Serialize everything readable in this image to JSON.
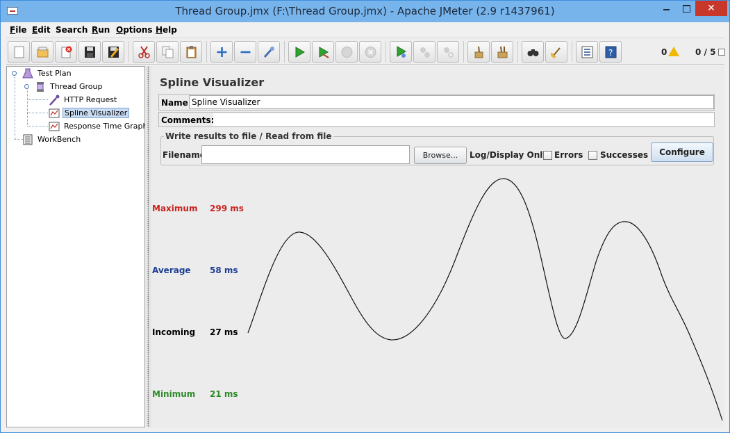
{
  "window": {
    "title": "Thread Group.jmx (F:\\Thread Group.jmx) - Apache JMeter (2.9 r1437961)",
    "controls": {
      "close": "✕"
    }
  },
  "menu": [
    {
      "accel": "F",
      "rest": "ile"
    },
    {
      "accel": "E",
      "rest": "dit"
    },
    {
      "accel": "",
      "rest": "Search"
    },
    {
      "accel": "R",
      "rest": "un"
    },
    {
      "accel": "O",
      "rest": "ptions"
    },
    {
      "accel": "H",
      "rest": "elp"
    }
  ],
  "toolbar": {
    "buttons": [
      {
        "icon": "new-icon"
      },
      {
        "icon": "open-icon"
      },
      {
        "icon": "close-file-icon"
      },
      {
        "icon": "save-icon"
      },
      {
        "icon": "save-as-icon"
      },
      {
        "icon": "cut-icon"
      },
      {
        "icon": "copy-icon"
      },
      {
        "icon": "paste-icon"
      },
      {
        "icon": "expand-icon"
      },
      {
        "icon": "collapse-icon"
      },
      {
        "icon": "toggle-icon"
      },
      {
        "icon": "start-icon"
      },
      {
        "icon": "start-no-timers-icon"
      },
      {
        "icon": "stop-icon"
      },
      {
        "icon": "shutdown-icon"
      },
      {
        "icon": "remote-start-icon"
      },
      {
        "icon": "remote-stop-icon"
      },
      {
        "icon": "remote-shutdown-icon"
      },
      {
        "icon": "clear-icon"
      },
      {
        "icon": "clear-all-icon"
      },
      {
        "icon": "search-icon"
      },
      {
        "icon": "reset-search-icon"
      },
      {
        "icon": "function-helper-icon"
      },
      {
        "icon": "help-icon"
      }
    ],
    "error_count": "0",
    "thread_count": "0 / 5"
  },
  "tree": {
    "items": [
      {
        "label": "Test Plan",
        "icon": "test-plan-icon"
      },
      {
        "label": "Thread Group",
        "icon": "thread-group-icon"
      },
      {
        "label": "HTTP Request",
        "icon": "sampler-pipette-icon"
      },
      {
        "label": "Spline Visualizer",
        "icon": "visualizer-icon"
      },
      {
        "label": "Response Time Graph",
        "icon": "visualizer-icon"
      },
      {
        "label": "WorkBench",
        "icon": "workbench-icon"
      }
    ],
    "selected": "Spline Visualizer"
  },
  "panel": {
    "title": "Spline Visualizer",
    "name_label": "Name:",
    "name_value": "Spline Visualizer",
    "comments_label": "Comments:",
    "comments_value": "",
    "file_group_legend": "Write results to file / Read from file",
    "filename_label": "Filename",
    "filename_value": "",
    "browse_label": "Browse...",
    "log_display_label": "Log/Display Only:",
    "errors_label": "Errors",
    "successes_label": "Successes",
    "configure_label": "Configure"
  },
  "stats": {
    "maximum": {
      "label": "Maximum",
      "value": "299 ms",
      "color": "#c8221f"
    },
    "average": {
      "label": "Average",
      "value": "58 ms",
      "color": "#1d3e93"
    },
    "incoming": {
      "label": "Incoming",
      "value": "27 ms",
      "color": "#000000"
    },
    "minimum": {
      "label": "Minimum",
      "value": "21 ms",
      "color": "#2f8a2a"
    }
  },
  "colors": {
    "title_bar": "#78b4ec",
    "close_button": "#c7372a",
    "selection": "#c9dcf3"
  }
}
